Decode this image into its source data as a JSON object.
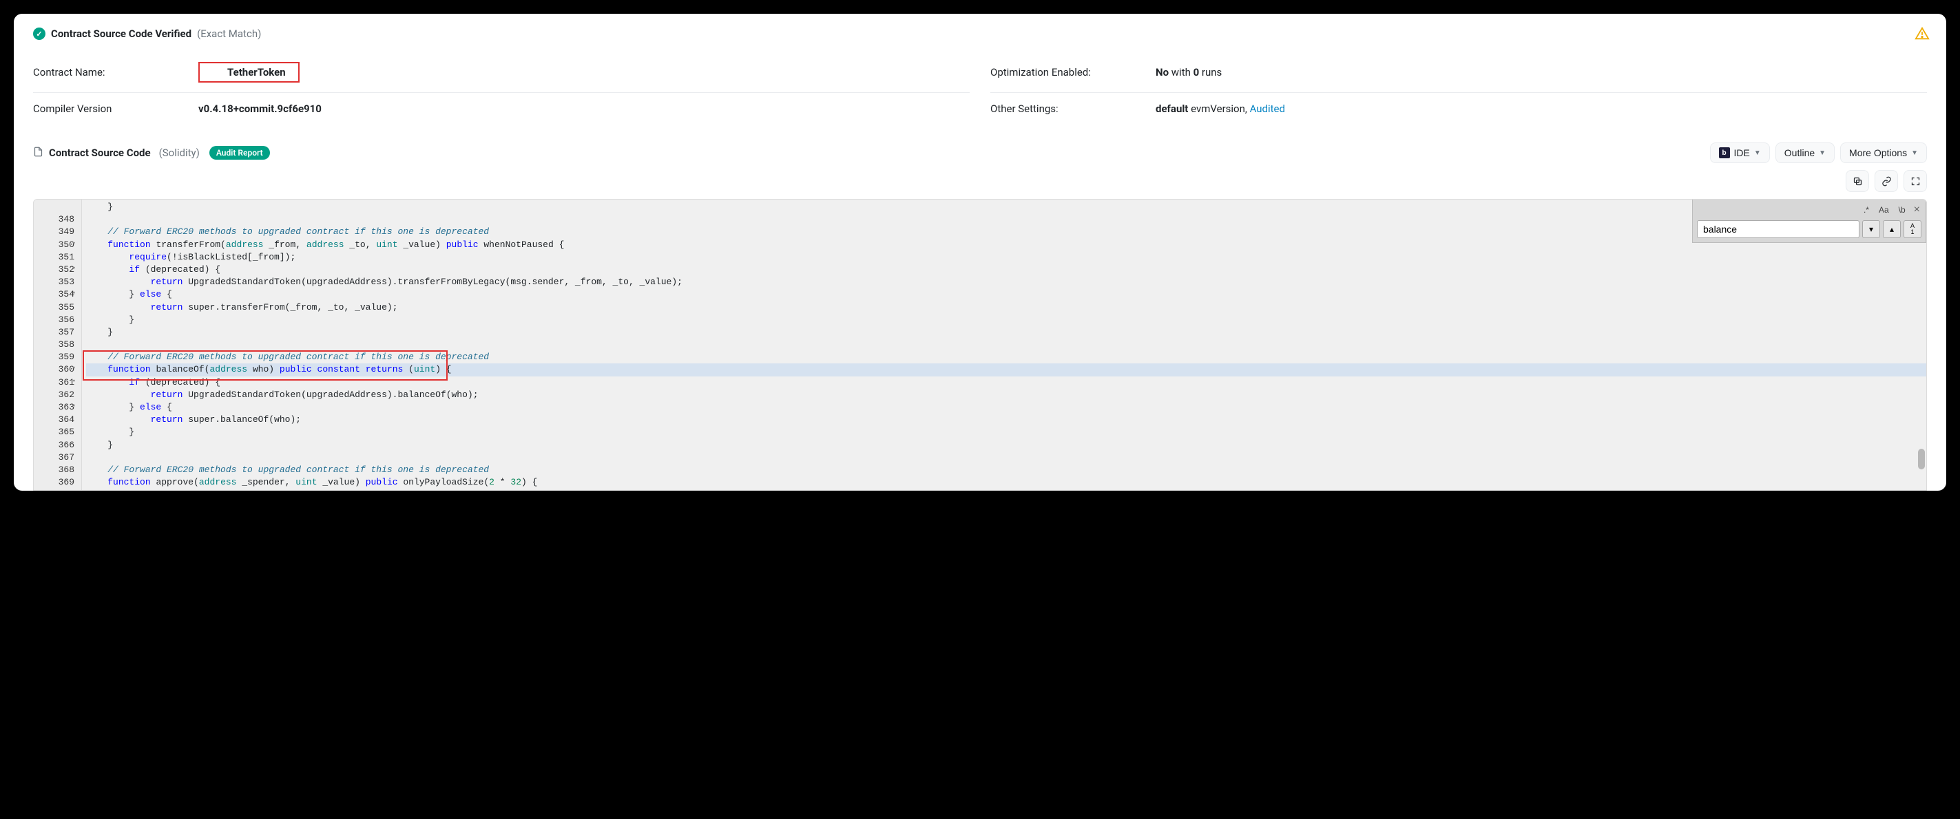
{
  "header": {
    "verified_title": "Contract Source Code Verified",
    "verified_sub": "(Exact Match)"
  },
  "meta": {
    "contract_name_label": "Contract Name:",
    "contract_name": "TetherToken",
    "compiler_label": "Compiler Version",
    "compiler_value": "v0.4.18+commit.9cf6e910",
    "optimization_label": "Optimization Enabled:",
    "optimization_no": "No",
    "optimization_with": " with ",
    "optimization_runs": "0",
    "optimization_runs_suffix": " runs",
    "other_label": "Other Settings:",
    "other_default": "default",
    "other_evm": " evmVersion, ",
    "other_audited": "Audited"
  },
  "section": {
    "title": "Contract Source Code",
    "lang": "(Solidity)",
    "audit_badge": "Audit Report",
    "btn_ide": "IDE",
    "btn_outline": "Outline",
    "btn_more": "More Options"
  },
  "search": {
    "opt_regex": ".*",
    "opt_case": "Aa",
    "opt_word": "\\b",
    "value": "balance",
    "all_label": "A\n1"
  },
  "code": {
    "lines": [
      {
        "n": "",
        "t": "    }"
      },
      {
        "n": "348",
        "t": ""
      },
      {
        "n": "349",
        "t": "    // Forward ERC20 methods to upgraded contract if this one is deprecated",
        "cls": "c"
      },
      {
        "n": "350",
        "fold": true,
        "t": "    function transferFrom(address _from, address _to, uint _value) public whenNotPaused {"
      },
      {
        "n": "351",
        "t": "        require(!isBlackListed[_from]);"
      },
      {
        "n": "352",
        "fold": true,
        "t": "        if (deprecated) {"
      },
      {
        "n": "353",
        "t": "            return UpgradedStandardToken(upgradedAddress).transferFromByLegacy(msg.sender, _from, _to, _value);"
      },
      {
        "n": "354",
        "fold": true,
        "t": "        } else {"
      },
      {
        "n": "355",
        "t": "            return super.transferFrom(_from, _to, _value);"
      },
      {
        "n": "356",
        "t": "        }"
      },
      {
        "n": "357",
        "t": "    }"
      },
      {
        "n": "358",
        "t": ""
      },
      {
        "n": "359",
        "t": "    // Forward ERC20 methods to upgraded contract if this one is deprecated",
        "cls": "c"
      },
      {
        "n": "360",
        "fold": true,
        "hl": true,
        "t": "    function balanceOf(address who) public constant returns (uint) {"
      },
      {
        "n": "361",
        "fold": true,
        "t": "        if (deprecated) {"
      },
      {
        "n": "362",
        "t": "            return UpgradedStandardToken(upgradedAddress).balanceOf(who);"
      },
      {
        "n": "363",
        "fold": true,
        "t": "        } else {"
      },
      {
        "n": "364",
        "t": "            return super.balanceOf(who);"
      },
      {
        "n": "365",
        "t": "        }"
      },
      {
        "n": "366",
        "t": "    }"
      },
      {
        "n": "367",
        "t": ""
      },
      {
        "n": "368",
        "t": "    // Forward ERC20 methods to upgraded contract if this one is deprecated",
        "cls": "c"
      },
      {
        "n": "369",
        "t": "    function approve(address _spender, uint _value) public onlyPayloadSize(2 * 32) {"
      }
    ]
  }
}
